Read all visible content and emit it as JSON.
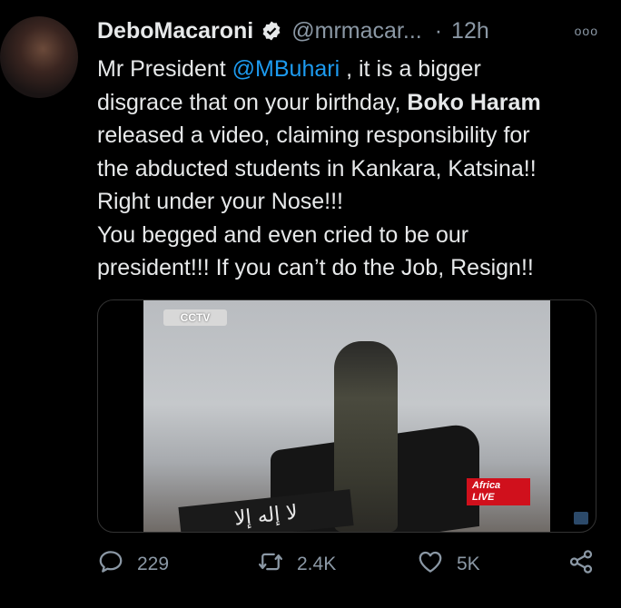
{
  "tweet": {
    "display_name": "DeboMacaroni",
    "handle": "@mrmacar...",
    "separator": "·",
    "time": "12h",
    "more": "ooo",
    "lines": [
      {
        "pre": "Mr President ",
        "mention": "@MBuhari",
        "post": " , it is a bigger"
      },
      {
        "pre": "disgrace that on your birthday, ",
        "bold": "Boko Haram"
      },
      {
        "text": "released a video, claiming responsibility for"
      },
      {
        "text": "the abducted students in Kankara, Katsina!!"
      },
      {
        "text": "Right under your Nose!!!"
      },
      {
        "text": "You begged and even cried to be our"
      },
      {
        "text": "president!!! If you can’t do the Job, Resign!!"
      }
    ]
  },
  "media": {
    "channel_logo": "CCTV",
    "banner_text": "ﻻ إله إلا",
    "africa_live_line1": "Africa",
    "africa_live_line2": "LIVE"
  },
  "actions": {
    "reply_count": "229",
    "retweet_count": "2.4K",
    "like_count": "5K"
  },
  "icons": {
    "verified": "verified-badge-icon",
    "reply": "reply-icon",
    "retweet": "retweet-icon",
    "like": "heart-icon",
    "share": "share-icon"
  },
  "colors": {
    "background": "#000000",
    "text": "#e7e9ea",
    "muted": "#8b98a5",
    "accent": "#1d9bf0"
  }
}
